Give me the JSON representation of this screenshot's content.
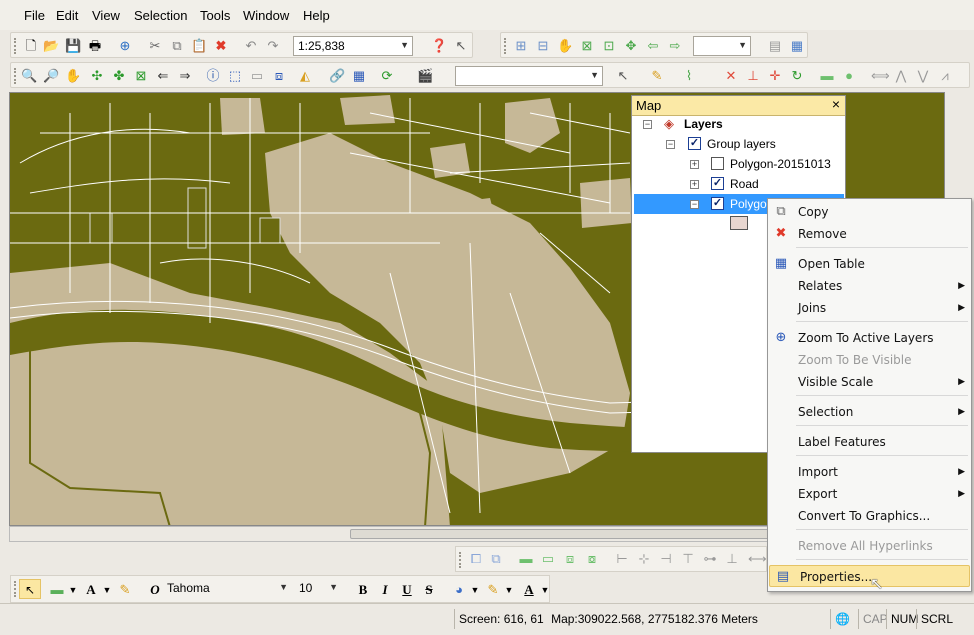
{
  "menu": [
    "File",
    "Edit",
    "View",
    "Selection",
    "Tools",
    "Window",
    "Help"
  ],
  "toolbar": {
    "scale_value": "1:25,838"
  },
  "draw_toolbar": {
    "font_name": "Tahoma",
    "font_size": "10",
    "bold": "B",
    "italic": "I",
    "underline": "U",
    "strike": "S"
  },
  "panel": {
    "title": "Map",
    "close": "×",
    "layers_root": "Layers",
    "group_label": "Group layers",
    "items": [
      {
        "label": "Polygon-20151013",
        "checked": false
      },
      {
        "label": "Road",
        "checked": true
      },
      {
        "label": "Polygon",
        "checked": true
      }
    ],
    "swatch_color": "#e8d6d0"
  },
  "context_menu": {
    "items": [
      {
        "label": "Copy",
        "icon": "copy-icon",
        "enabled": true
      },
      {
        "label": "Remove",
        "icon": "remove-icon",
        "enabled": true
      },
      {
        "label": "Open Table",
        "icon": "table-icon",
        "enabled": true
      },
      {
        "label": "Relates",
        "enabled": true,
        "submenu": true
      },
      {
        "label": "Joins",
        "enabled": true,
        "submenu": true
      },
      {
        "label": "Zoom To Active Layers",
        "icon": "zoom-layer-icon",
        "enabled": true
      },
      {
        "label": "Zoom To Be Visible",
        "enabled": false
      },
      {
        "label": "Visible Scale",
        "enabled": true,
        "submenu": true
      },
      {
        "label": "Selection",
        "enabled": true,
        "submenu": true
      },
      {
        "label": "Label Features",
        "enabled": true
      },
      {
        "label": "Import",
        "enabled": true,
        "submenu": true
      },
      {
        "label": "Export",
        "enabled": true,
        "submenu": true
      },
      {
        "label": "Convert To Graphics...",
        "enabled": true
      },
      {
        "label": "Remove All Hyperlinks",
        "enabled": false
      },
      {
        "label": "Properties...",
        "icon": "properties-icon",
        "enabled": true,
        "highlighted": true
      }
    ]
  },
  "status": {
    "screen": "Screen: 616, 61",
    "map": "Map:309022.568, 2775182.376 Meters",
    "cap": "CAP",
    "num": "NUM",
    "scrl": "SCRL"
  },
  "colors": {
    "map_background": "#6b6a10",
    "land": "#c6b897",
    "road": "#ffffff",
    "menu_highlight": "#fbe7a2"
  }
}
